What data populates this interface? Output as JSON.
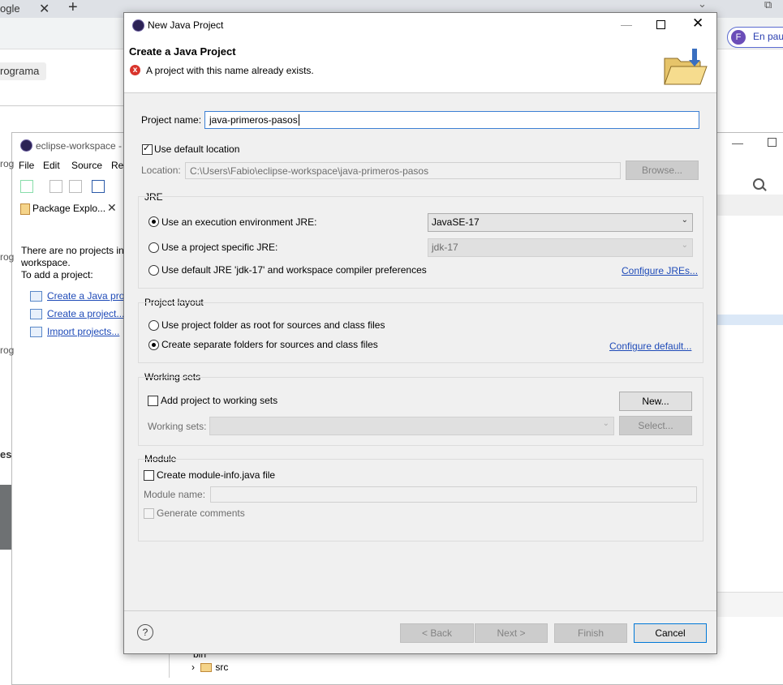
{
  "browser": {
    "tab_text": "ogle",
    "close_glyph": "✕",
    "newtab_glyph": "+",
    "profile_initial": "F",
    "profile_text": "En pau",
    "chip_text": "rograma",
    "chevron_glyph": "⌄",
    "min_glyph": "⧉"
  },
  "eclipse": {
    "title": "eclipse-workspace - j",
    "menu": [
      "File",
      "Edit",
      "Source",
      "Ref"
    ],
    "view_tab": "Package Explo...",
    "view_close": "✕",
    "empty_lines": [
      "There are no projects in y",
      "workspace.",
      "To add a project:"
    ],
    "links": [
      "Create a Java proje",
      "Create a project...",
      "Import projects..."
    ],
    "left_fragment_es": "es",
    "left_fragment_rog": "rog",
    "min_glyph": "—",
    "tree": [
      "bin",
      "src"
    ]
  },
  "dialog": {
    "title": "New Java Project",
    "min_glyph": "—",
    "close_glyph": "✕",
    "heading": "Create a Java Project",
    "error_icon": "x",
    "error_text": "A project with this name already exists.",
    "project_name_label": "Project name:",
    "project_name_value": "java-primeros-pasos",
    "use_default_location_label": "Use default location",
    "use_default_location_checked": true,
    "location_label": "Location:",
    "location_value": "C:\\Users\\Fabio\\eclipse-workspace\\java-primeros-pasos",
    "browse_button": "Browse...",
    "jre": {
      "group_label": "JRE",
      "option1": "Use an execution environment JRE:",
      "option1_value": "JavaSE-17",
      "option2": "Use a project specific JRE:",
      "option2_value": "jdk-17",
      "option3": "Use default JRE 'jdk-17' and workspace compiler preferences",
      "configure_link": "Configure JREs...",
      "selected_option": 1
    },
    "layout": {
      "group_label": "Project layout",
      "option1": "Use project folder as root for sources and class files",
      "option2": "Create separate folders for sources and class files",
      "configure_link": "Configure default...",
      "selected_option": 2
    },
    "working_sets": {
      "group_label": "Working sets",
      "add_label": "Add project to working sets",
      "add_checked": false,
      "new_button": "New...",
      "sets_label": "Working sets:",
      "select_button": "Select..."
    },
    "module": {
      "group_label": "Module",
      "create_label": "Create module-info.java file",
      "create_checked": false,
      "name_label": "Module name:",
      "comments_label": "Generate comments"
    },
    "footer": {
      "help_glyph": "?",
      "back": "< Back",
      "next": "Next >",
      "finish": "Finish",
      "cancel": "Cancel"
    }
  },
  "icons": {
    "dropdown": "⌄",
    "checkmark": "✓",
    "error": "error-icon",
    "folder": "folder-icon"
  }
}
